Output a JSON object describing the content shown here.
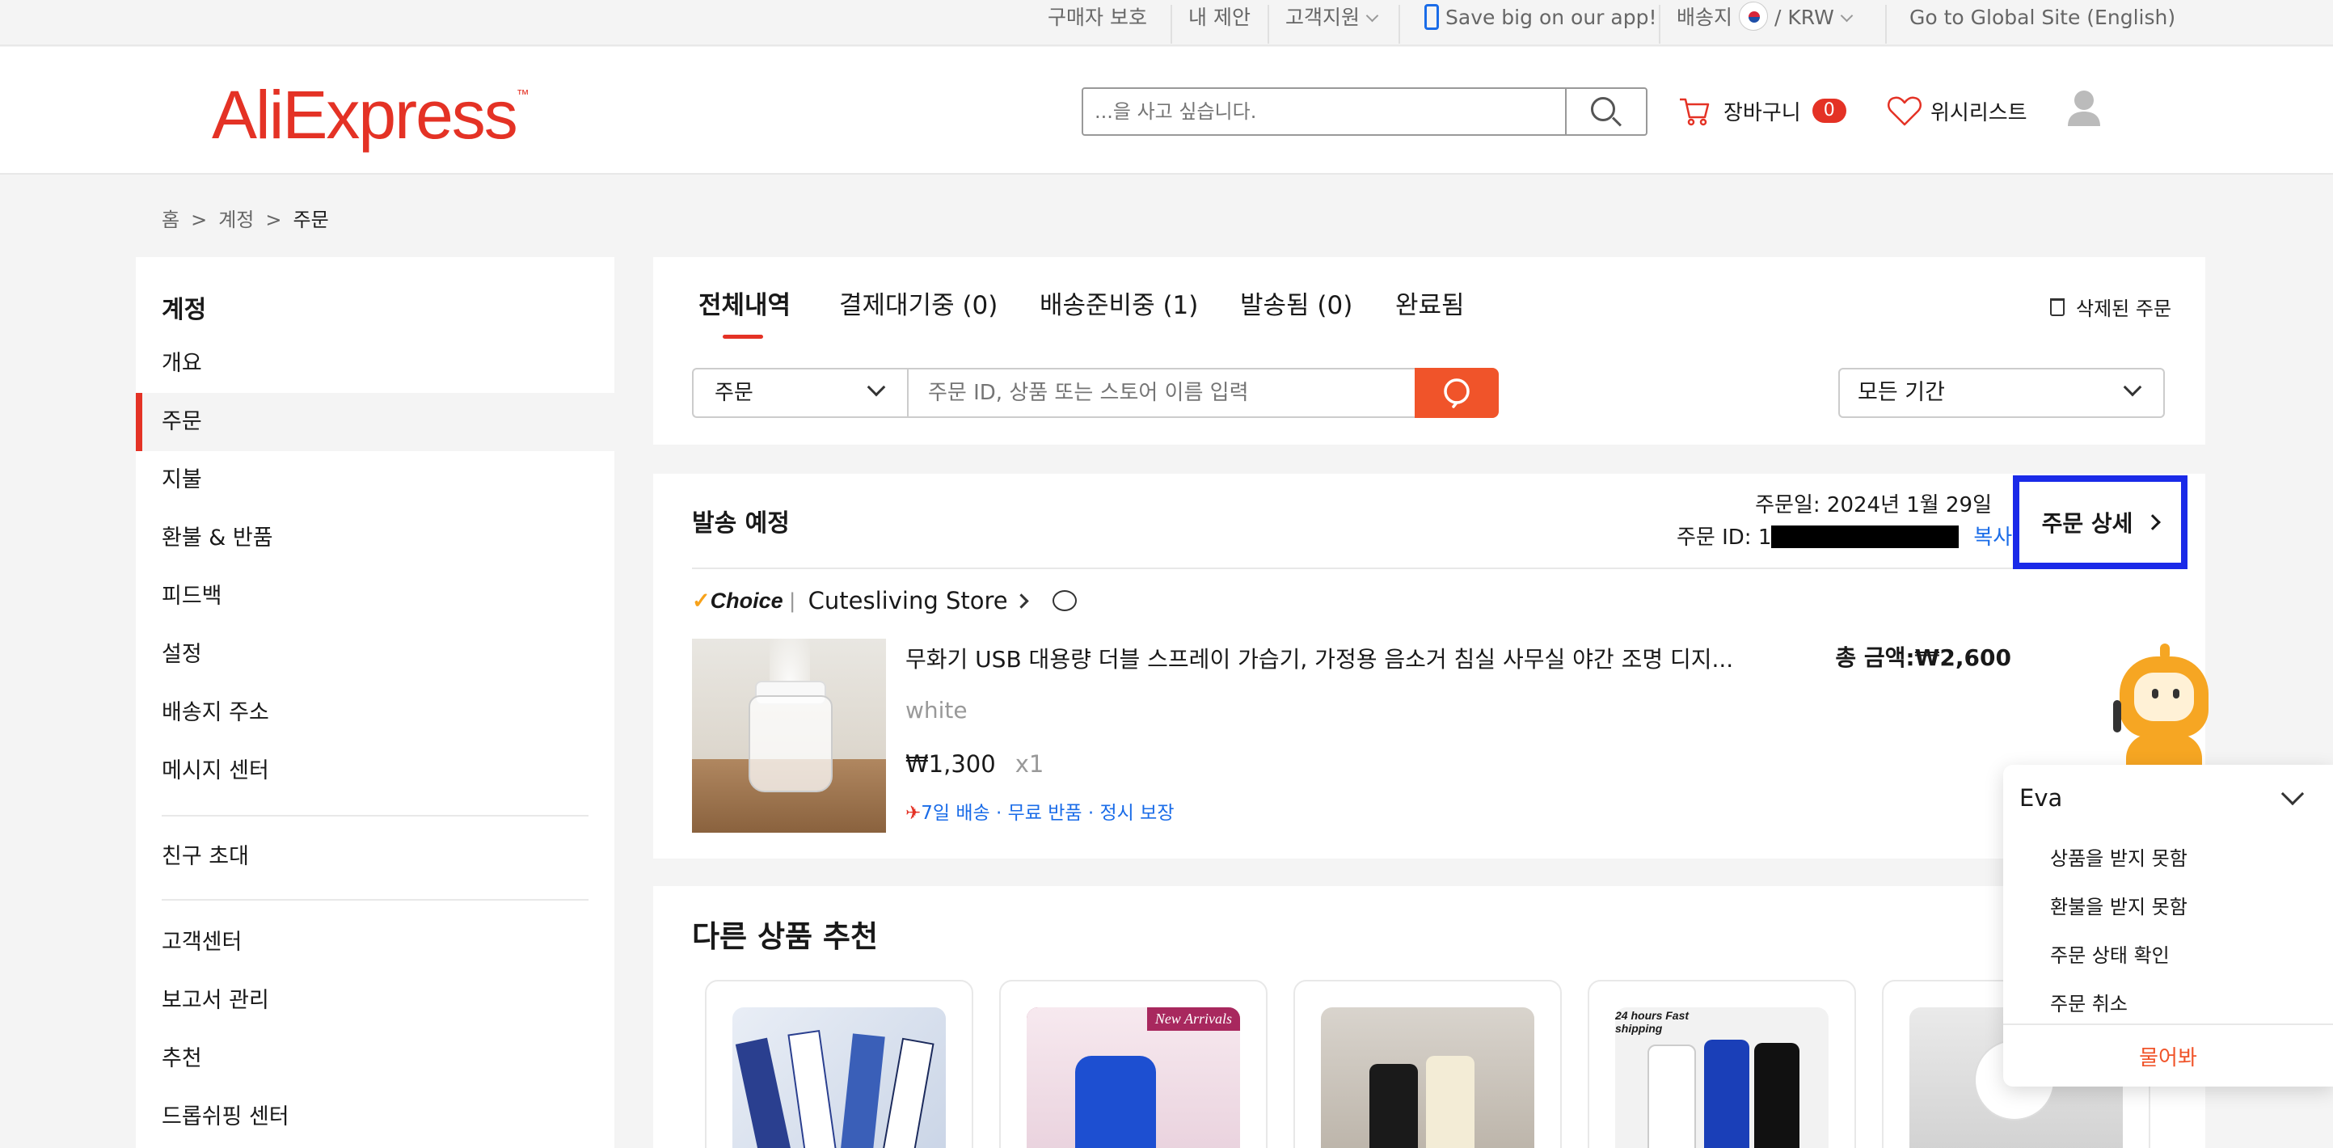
{
  "topbar": {
    "buyer_protection": "구매자 보호",
    "my_suggestions": "내 제안",
    "customer_support": "고객지원",
    "app_promo": "Save big on our app!",
    "ship_to_label": "배송지",
    "currency_sep": "/",
    "currency": "KRW",
    "global_site": "Go to Global Site (English)"
  },
  "header": {
    "logo": "AliExpress",
    "search_placeholder": "...을 사고 싶습니다.",
    "cart_label": "장바구니",
    "cart_count": "0",
    "wishlist_label": "위시리스트"
  },
  "breadcrumb": {
    "items": [
      "홈",
      ">",
      "계정",
      ">",
      "주문"
    ]
  },
  "sidebar": {
    "title": "계정",
    "items": [
      "개요",
      "주문",
      "지불",
      "환불 & 반품",
      "피드백",
      "설정",
      "배송지 주소",
      "메시지 센터"
    ],
    "group2": [
      "친구 초대"
    ],
    "group3": [
      "고객센터",
      "보고서 관리",
      "추천",
      "드롭쉬핑 센터"
    ],
    "active_item": "주문"
  },
  "orders": {
    "tabs": [
      "전체내역",
      "결제대기중 (0)",
      "배송준비중 (1)",
      "발송됨 (0)",
      "완료됨"
    ],
    "deleted_orders": "삭제된 주문",
    "filter_type": "주문",
    "search_placeholder": "주문 ID, 상품 또는 스토어 이름 입력",
    "period": "모든 기간"
  },
  "order": {
    "status": "발송 예정",
    "date": "주문일: 2024년 1월 29일",
    "id_label": "주문 ID: 1",
    "copy": "복사",
    "detail_button": "주문 상세",
    "choice_label": "Choice",
    "store_name": "Cutesliving Store",
    "product_title": "무화기 USB 대용량 더블 스프레이 가습기, 가정용 음소거 침실 사무실 야간 조명 디지...",
    "variant": "white",
    "price": "₩1,300",
    "quantity": "x1",
    "perks": "7일 배송 · 무료 반품 · 정시 보장",
    "total": "총 금액:₩2,600"
  },
  "recommendations": {
    "title": "다른 상품 추천",
    "card_badges": [
      "",
      "New Arrivals",
      "",
      "24 hours Fast shipping",
      ""
    ]
  },
  "assistant": {
    "name": "Eva",
    "options": [
      "상품을 받지 못함",
      "환불을 받지 못함",
      "주문 상태 확인",
      "주문 취소"
    ],
    "ask": "물어봐"
  },
  "colors": {
    "brand": "#e43225",
    "accent_orange": "#f0542a",
    "link_blue": "#1a6ce8",
    "highlight_box": "#1a2ae8"
  }
}
